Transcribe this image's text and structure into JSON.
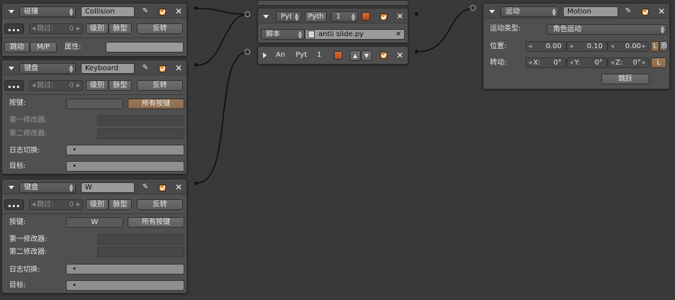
{
  "sensors": [
    {
      "type": "碰撞",
      "name": "Collision",
      "skip_label": "跳过:",
      "skip_value": "0",
      "level": "级别",
      "tap": "脉型",
      "invert": "反转",
      "pulse": "跳动",
      "mp": "M/P",
      "property_label": "属性:"
    },
    {
      "type": "键盘",
      "name": "Keyboard",
      "skip_label": "跳过:",
      "skip_value": "0",
      "level": "级别",
      "tap": "脉型",
      "invert": "反转",
      "key_label": "按键:",
      "key_value": "",
      "all_keys": "所有按键",
      "first_modifier": "第一修改器:",
      "second_modifier": "第二修改器:",
      "log_toggle": "日志切换:",
      "target": "目标:",
      "log_value": "•",
      "target_value": "•"
    },
    {
      "type": "键盘",
      "name": "W",
      "skip_label": "跳过:",
      "skip_value": "0",
      "level": "级别",
      "tap": "脉型",
      "invert": "反转",
      "key_label": "按键:",
      "key_value": "W",
      "all_keys": "所有按键",
      "first_modifier": "第一修改器:",
      "second_modifier": "第二修改器:",
      "log_toggle": "日志切换:",
      "target": "目标:",
      "log_value": "•",
      "target_value": "•"
    }
  ],
  "controllers": [
    {
      "type": "Pyt",
      "name": "Pyth",
      "state": "1",
      "script_label": "脚本",
      "script_file": "antii slide.py"
    },
    {
      "collapsed_type": "An",
      "collapsed_mode": "Pyt",
      "state": "1"
    }
  ],
  "actuator": {
    "type": "运动",
    "name": "Motion",
    "motion_type_label": "运动类型:",
    "motion_type": "角色运动",
    "loc_label": "位置:",
    "loc": [
      "0.00",
      "0.10",
      "0.00"
    ],
    "loc_local": "L",
    "loc_extra": "添",
    "rot_label": "转动:",
    "rot": [
      {
        "axis": "X:",
        "value": "0°"
      },
      {
        "axis": "Y:",
        "value": "0°"
      },
      {
        "axis": "Z:",
        "value": "0°"
      }
    ],
    "rot_local": "L",
    "jump": "跳跃"
  },
  "colors": {
    "background": "#393939",
    "panel": "#505050",
    "accent": "#e88c2c",
    "all_keys_button": "#9b7856"
  }
}
